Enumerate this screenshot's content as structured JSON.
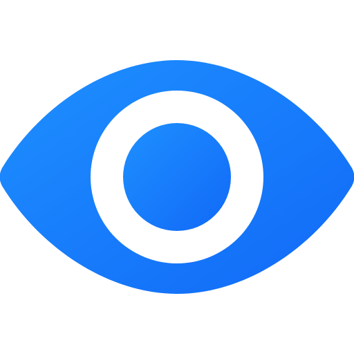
{
  "icon": {
    "name": "eye-icon",
    "gradient_start": "#1E90FF",
    "gradient_end": "#1169F7",
    "highlight": "#FFFFFF",
    "background": "#FFFFFF"
  }
}
